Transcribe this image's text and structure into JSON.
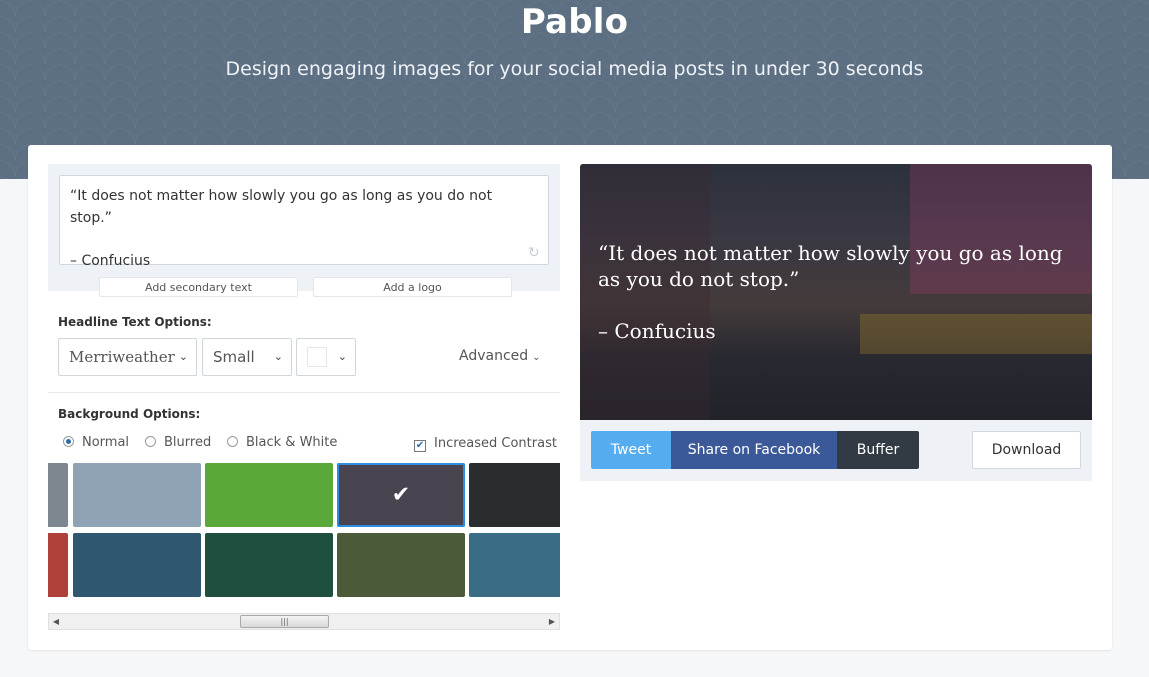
{
  "header": {
    "title": "Pablo",
    "subtitle": "Design engaging images for your social media posts in under 30 seconds"
  },
  "editor": {
    "quote": "“It does not matter how slowly you go as long as you do not stop.”",
    "author": "– Confucius",
    "add_secondary": "Add secondary text",
    "add_logo": "Add a logo"
  },
  "headline_options": {
    "label": "Headline Text Options:",
    "font": "Merriweather",
    "size": "Small",
    "color": "#ffffff",
    "advanced": "Advanced"
  },
  "background_options": {
    "label": "Background Options:",
    "filters": [
      {
        "label": "Normal",
        "selected": true
      },
      {
        "label": "Blurred",
        "selected": false
      },
      {
        "label": "Black & White",
        "selected": false
      }
    ],
    "increased_contrast": {
      "label": "Increased Contrast",
      "checked": true
    }
  },
  "thumbnails": [
    {
      "name": "rocks",
      "color": "#7d8790"
    },
    {
      "name": "bridge",
      "color": "#8fa3b5"
    },
    {
      "name": "clover",
      "color": "#5aa83a"
    },
    {
      "name": "city-street",
      "color": "#4a4350",
      "selected": true
    },
    {
      "name": "dark-texture",
      "color": "#2a2c30"
    },
    {
      "name": "red-flower",
      "color": "#b0403a"
    },
    {
      "name": "ocean",
      "color": "#2f5870"
    },
    {
      "name": "green-plant",
      "color": "#1f4f3e"
    },
    {
      "name": "forest",
      "color": "#4b5a38"
    },
    {
      "name": "blue-wall",
      "color": "#3a6c86"
    }
  ],
  "preview": {
    "quote": "“It does not matter how slowly you go as long as you do not stop.”",
    "author": "– Confucius"
  },
  "share": {
    "tweet": "Tweet",
    "facebook": "Share on Facebook",
    "buffer": "Buffer",
    "download": "Download"
  }
}
